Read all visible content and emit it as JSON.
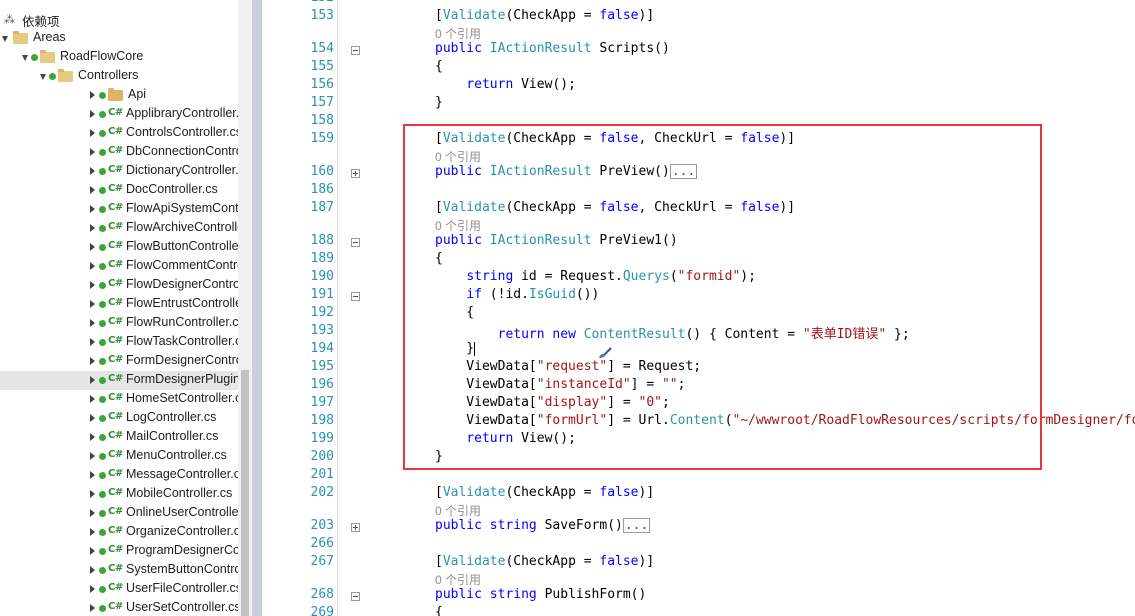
{
  "explorer": {
    "top_text": "...",
    "items": [
      {
        "label": "依赖项",
        "kind": "deps",
        "indent": 0,
        "arrow": "none"
      },
      {
        "label": "Areas",
        "kind": "folder",
        "indent": 0,
        "arrow": "expanded"
      },
      {
        "label": "RoadFlowCore",
        "kind": "folder",
        "indent": 1,
        "arrow": "expanded"
      },
      {
        "label": "Controllers",
        "kind": "folder",
        "indent": 2,
        "arrow": "expanded"
      },
      {
        "label": "Api",
        "kind": "folder",
        "indent": 3,
        "arrow": "collapsed"
      },
      {
        "label": "ApplibraryController.cs",
        "kind": "cs",
        "indent": 3,
        "arrow": "collapsed"
      },
      {
        "label": "ControlsController.cs",
        "kind": "cs",
        "indent": 3,
        "arrow": "collapsed"
      },
      {
        "label": "DbConnectionController.cs",
        "kind": "cs",
        "indent": 3,
        "arrow": "collapsed"
      },
      {
        "label": "DictionaryController.cs",
        "kind": "cs",
        "indent": 3,
        "arrow": "collapsed"
      },
      {
        "label": "DocController.cs",
        "kind": "cs",
        "indent": 3,
        "arrow": "collapsed"
      },
      {
        "label": "FlowApiSystemController.cs",
        "kind": "cs",
        "indent": 3,
        "arrow": "collapsed"
      },
      {
        "label": "FlowArchiveController.cs",
        "kind": "cs",
        "indent": 3,
        "arrow": "collapsed"
      },
      {
        "label": "FlowButtonController.cs",
        "kind": "cs",
        "indent": 3,
        "arrow": "collapsed"
      },
      {
        "label": "FlowCommentController.cs",
        "kind": "cs",
        "indent": 3,
        "arrow": "collapsed"
      },
      {
        "label": "FlowDesignerController.cs",
        "kind": "cs",
        "indent": 3,
        "arrow": "collapsed"
      },
      {
        "label": "FlowEntrustController.cs",
        "kind": "cs",
        "indent": 3,
        "arrow": "collapsed"
      },
      {
        "label": "FlowRunController.cs",
        "kind": "cs",
        "indent": 3,
        "arrow": "collapsed"
      },
      {
        "label": "FlowTaskController.cs",
        "kind": "cs",
        "indent": 3,
        "arrow": "collapsed"
      },
      {
        "label": "FormDesignerController.cs",
        "kind": "cs",
        "indent": 3,
        "arrow": "collapsed"
      },
      {
        "label": "FormDesignerPluginControl",
        "kind": "cs",
        "indent": 3,
        "arrow": "collapsed",
        "selected": true
      },
      {
        "label": "HomeSetController.cs",
        "kind": "cs",
        "indent": 3,
        "arrow": "collapsed"
      },
      {
        "label": "LogController.cs",
        "kind": "cs",
        "indent": 3,
        "arrow": "collapsed"
      },
      {
        "label": "MailController.cs",
        "kind": "cs",
        "indent": 3,
        "arrow": "collapsed"
      },
      {
        "label": "MenuController.cs",
        "kind": "cs",
        "indent": 3,
        "arrow": "collapsed"
      },
      {
        "label": "MessageController.cs",
        "kind": "cs",
        "indent": 3,
        "arrow": "collapsed"
      },
      {
        "label": "MobileController.cs",
        "kind": "cs",
        "indent": 3,
        "arrow": "collapsed"
      },
      {
        "label": "OnlineUserController.cs",
        "kind": "cs",
        "indent": 3,
        "arrow": "collapsed"
      },
      {
        "label": "OrganizeController.cs",
        "kind": "cs",
        "indent": 3,
        "arrow": "collapsed"
      },
      {
        "label": "ProgramDesignerController",
        "kind": "cs",
        "indent": 3,
        "arrow": "collapsed"
      },
      {
        "label": "SystemButtonController.cs",
        "kind": "cs",
        "indent": 3,
        "arrow": "collapsed"
      },
      {
        "label": "UserFileController.cs",
        "kind": "cs",
        "indent": 3,
        "arrow": "collapsed"
      },
      {
        "label": "UserSetController.cs",
        "kind": "cs",
        "indent": 3,
        "arrow": "collapsed"
      }
    ],
    "cs_icon_text": "C#"
  },
  "editor": {
    "lens_text": "0 个引用",
    "collapsed_text": "...",
    "rows": [
      {
        "num": "152",
        "tokens": []
      },
      {
        "num": "153",
        "tokens": [
          [
            "p",
            "["
          ],
          [
            "t",
            "Validate"
          ],
          [
            "p",
            "(CheckApp = "
          ],
          [
            "k",
            "false"
          ],
          [
            "p",
            ")]"
          ]
        ]
      },
      {
        "lens": true
      },
      {
        "num": "154",
        "fold": "minus",
        "tokens": [
          [
            "k",
            "public"
          ],
          [
            "p",
            " "
          ],
          [
            "t",
            "IActionResult"
          ],
          [
            "p",
            " Scripts()"
          ]
        ]
      },
      {
        "num": "155",
        "tokens": [
          [
            "p",
            "{"
          ]
        ]
      },
      {
        "num": "156",
        "tokens": [
          [
            "p",
            "    "
          ],
          [
            "k",
            "return"
          ],
          [
            "p",
            " View();"
          ]
        ]
      },
      {
        "num": "157",
        "tokens": [
          [
            "p",
            "}"
          ]
        ]
      },
      {
        "num": "158",
        "tokens": []
      },
      {
        "num": "159",
        "tokens": [
          [
            "p",
            "["
          ],
          [
            "t",
            "Validate"
          ],
          [
            "p",
            "(CheckApp = "
          ],
          [
            "k",
            "false"
          ],
          [
            "p",
            ", CheckUrl = "
          ],
          [
            "k",
            "false"
          ],
          [
            "p",
            ")]"
          ]
        ]
      },
      {
        "lens": true
      },
      {
        "num": "160",
        "fold": "plus",
        "collapsed": true,
        "tokens": [
          [
            "k",
            "public"
          ],
          [
            "p",
            " "
          ],
          [
            "t",
            "IActionResult"
          ],
          [
            "p",
            " PreView()"
          ]
        ]
      },
      {
        "num": "186",
        "tokens": []
      },
      {
        "num": "187",
        "tokens": [
          [
            "p",
            "["
          ],
          [
            "t",
            "Validate"
          ],
          [
            "p",
            "(CheckApp = "
          ],
          [
            "k",
            "false"
          ],
          [
            "p",
            ", CheckUrl = "
          ],
          [
            "k",
            "false"
          ],
          [
            "p",
            ")]"
          ]
        ]
      },
      {
        "lens": true
      },
      {
        "num": "188",
        "fold": "minus",
        "tokens": [
          [
            "k",
            "public"
          ],
          [
            "p",
            " "
          ],
          [
            "t",
            "IActionResult"
          ],
          [
            "p",
            " PreView1()"
          ]
        ]
      },
      {
        "num": "189",
        "tokens": [
          [
            "p",
            "{"
          ]
        ]
      },
      {
        "num": "190",
        "tokens": [
          [
            "p",
            "    "
          ],
          [
            "k",
            "string"
          ],
          [
            "p",
            " id = Request."
          ],
          [
            "t",
            "Querys"
          ],
          [
            "p",
            "("
          ],
          [
            "s",
            "\"formid\""
          ],
          [
            "p",
            ");"
          ]
        ]
      },
      {
        "num": "191",
        "fold": "minus",
        "tokens": [
          [
            "p",
            "    "
          ],
          [
            "k",
            "if"
          ],
          [
            "p",
            " (!id."
          ],
          [
            "t",
            "IsGuid"
          ],
          [
            "p",
            "())"
          ]
        ]
      },
      {
        "num": "192",
        "tokens": [
          [
            "p",
            "    {"
          ]
        ]
      },
      {
        "num": "193",
        "tokens": [
          [
            "p",
            "        "
          ],
          [
            "k",
            "return"
          ],
          [
            "p",
            " "
          ],
          [
            "k",
            "new"
          ],
          [
            "p",
            " "
          ],
          [
            "t",
            "ContentResult"
          ],
          [
            "p",
            "() { Content = "
          ],
          [
            "s",
            "\"表单ID错误\""
          ],
          [
            "p",
            " };"
          ]
        ]
      },
      {
        "num": "194",
        "cursor": true,
        "tokens": [
          [
            "p",
            "    }"
          ]
        ]
      },
      {
        "num": "195",
        "tokens": [
          [
            "p",
            "    ViewData["
          ],
          [
            "s",
            "\"request\""
          ],
          [
            "p",
            "] = Request;"
          ]
        ]
      },
      {
        "num": "196",
        "tokens": [
          [
            "p",
            "    ViewData["
          ],
          [
            "s",
            "\"instanceId\""
          ],
          [
            "p",
            "] = "
          ],
          [
            "s",
            "\"\""
          ],
          [
            "p",
            ";"
          ]
        ]
      },
      {
        "num": "197",
        "tokens": [
          [
            "p",
            "    ViewData["
          ],
          [
            "s",
            "\"display\""
          ],
          [
            "p",
            "] = "
          ],
          [
            "s",
            "\"0\""
          ],
          [
            "p",
            ";"
          ]
        ]
      },
      {
        "num": "198",
        "tokens": [
          [
            "p",
            "    ViewData["
          ],
          [
            "s",
            "\"formUrl\""
          ],
          [
            "p",
            "] = Url."
          ],
          [
            "t",
            "Content"
          ],
          [
            "p",
            "("
          ],
          [
            "s",
            "\"~/wwwroot/RoadFlowResources/scripts/formDesigner/form/"
          ]
        ]
      },
      {
        "num": "199",
        "tokens": [
          [
            "p",
            "    "
          ],
          [
            "k",
            "return"
          ],
          [
            "p",
            " View();"
          ]
        ]
      },
      {
        "num": "200",
        "tokens": [
          [
            "p",
            "}"
          ]
        ]
      },
      {
        "num": "201",
        "tokens": []
      },
      {
        "num": "202",
        "tokens": [
          [
            "p",
            "["
          ],
          [
            "t",
            "Validate"
          ],
          [
            "p",
            "(CheckApp = "
          ],
          [
            "k",
            "false"
          ],
          [
            "p",
            ")]"
          ]
        ]
      },
      {
        "lens": true
      },
      {
        "num": "203",
        "fold": "plus",
        "collapsed": true,
        "tokens": [
          [
            "k",
            "public"
          ],
          [
            "p",
            " "
          ],
          [
            "k",
            "string"
          ],
          [
            "p",
            " SaveForm()"
          ]
        ]
      },
      {
        "num": "266",
        "tokens": []
      },
      {
        "num": "267",
        "tokens": [
          [
            "p",
            "["
          ],
          [
            "t",
            "Validate"
          ],
          [
            "p",
            "(CheckApp = "
          ],
          [
            "k",
            "false"
          ],
          [
            "p",
            ")]"
          ]
        ]
      },
      {
        "lens": true
      },
      {
        "num": "268",
        "fold": "minus",
        "tokens": [
          [
            "k",
            "public"
          ],
          [
            "p",
            " "
          ],
          [
            "k",
            "string"
          ],
          [
            "p",
            " PublishForm()"
          ]
        ]
      },
      {
        "num": "269",
        "tokens": [
          [
            "p",
            "{"
          ]
        ]
      }
    ]
  },
  "colors": {
    "keyword": "#0000ff",
    "type": "#2b91af",
    "string": "#a31515",
    "highlight_box": "#e8383d"
  }
}
